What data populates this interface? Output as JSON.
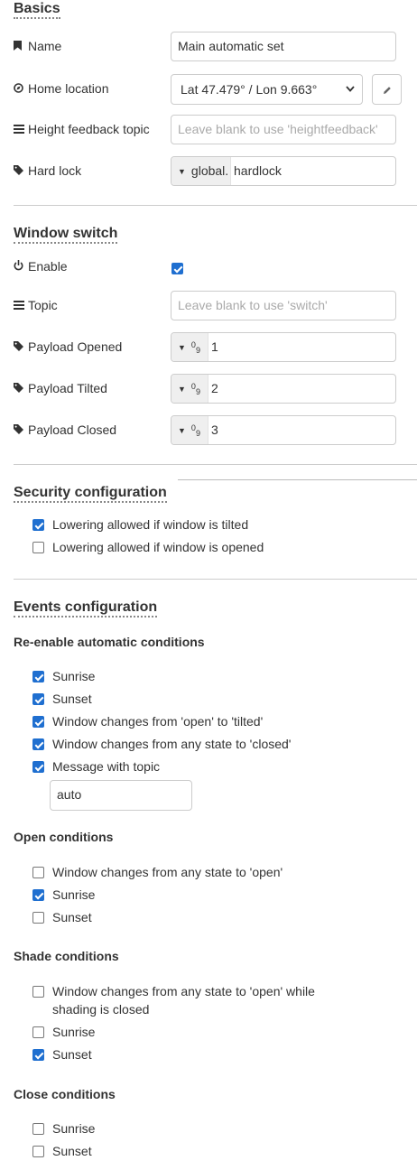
{
  "basics": {
    "title": "Basics",
    "name": {
      "label": "Name",
      "icon": "bookmark-icon",
      "value": "Main automatic set"
    },
    "home_location": {
      "label": "Home location",
      "icon": "location-icon",
      "selected": "Lat 47.479° / Lon 9.663°",
      "edit_icon": "pencil-icon"
    },
    "height_feedback": {
      "label": "Height feedback topic",
      "icon": "tasks-icon",
      "placeholder": "Leave blank to use 'heightfeedback'"
    },
    "hard_lock": {
      "label": "Hard lock",
      "icon": "tag-icon",
      "type_prefix": "global.",
      "value": "hardlock"
    }
  },
  "window_switch": {
    "title": "Window switch",
    "enable": {
      "label": "Enable",
      "icon": "power-icon",
      "checked": true
    },
    "topic": {
      "label": "Topic",
      "icon": "tasks-icon",
      "placeholder": "Leave blank to use 'switch'"
    },
    "payload_opened": {
      "label": "Payload Opened",
      "icon": "tag-icon",
      "value": "1"
    },
    "payload_tilted": {
      "label": "Payload Tilted",
      "icon": "tag-icon",
      "value": "2"
    },
    "payload_closed": {
      "label": "Payload Closed",
      "icon": "tag-icon",
      "value": "3"
    }
  },
  "security": {
    "title": "Security configuration",
    "items": [
      {
        "label": "Lowering allowed if window is tilted",
        "checked": true
      },
      {
        "label": "Lowering allowed if window is opened",
        "checked": false
      }
    ]
  },
  "events": {
    "title": "Events configuration",
    "reenable": {
      "title": "Re-enable automatic conditions",
      "items": [
        {
          "label": "Sunrise",
          "checked": true
        },
        {
          "label": "Sunset",
          "checked": true
        },
        {
          "label": "Window changes from 'open' to 'tilted'",
          "checked": true
        },
        {
          "label": "Window changes from any state to 'closed'",
          "checked": true
        },
        {
          "label": "Message with topic",
          "checked": true
        }
      ],
      "topic_value": "auto"
    },
    "open": {
      "title": "Open conditions",
      "items": [
        {
          "label": "Window changes from any state to 'open'",
          "checked": false
        },
        {
          "label": "Sunrise",
          "checked": true
        },
        {
          "label": "Sunset",
          "checked": false
        }
      ]
    },
    "shade": {
      "title": "Shade conditions",
      "items": [
        {
          "label": "Window changes from any state to 'open' while",
          "label_line2": "shading is closed",
          "checked": false
        },
        {
          "label": "Sunrise",
          "checked": false
        },
        {
          "label": "Sunset",
          "checked": true
        }
      ]
    },
    "close": {
      "title": "Close conditions",
      "items": [
        {
          "label": "Sunrise",
          "checked": false
        },
        {
          "label": "Sunset",
          "checked": false
        }
      ]
    }
  },
  "colors": {
    "accent": "#1f6fd0",
    "border": "#cccccc",
    "text": "#333333",
    "placeholder": "#aaaaaa"
  }
}
